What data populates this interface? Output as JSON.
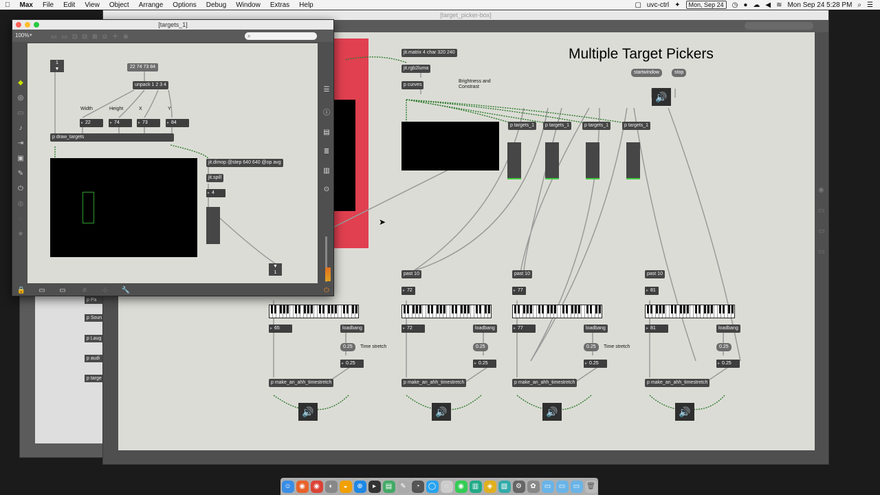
{
  "menubar": {
    "apple": "",
    "app": "Max",
    "items": [
      "File",
      "Edit",
      "View",
      "Object",
      "Arrange",
      "Options",
      "Debug",
      "Window",
      "Extras",
      "Help"
    ],
    "status_item": "uvc-ctrl",
    "date_box": "Mon, Sep 24",
    "clock": "Mon Sep 24  5:28 PM"
  },
  "main_window": {
    "title": "[target_picker-box]",
    "heading": "Multiple Target Pickers",
    "objects": {
      "matrix": "jit.matrix 4 char 320 240",
      "rgb2luma": "jit.rgb2luma",
      "curves": "p curves",
      "brightness_comment": "Brightness and Constrast",
      "startwindow": "startwindow",
      "stop": "stop",
      "targets": [
        "p targets_1",
        "p targets_1",
        "p targets_1",
        "p targets_1"
      ],
      "past": [
        "past 10",
        "past 10",
        "past 10",
        "past 10"
      ],
      "pitch_values": [
        "72",
        "77",
        "81"
      ],
      "note_values": [
        "65",
        "72",
        "77",
        "81"
      ],
      "loadbang": "loadbang",
      "stretch_value": "0.25",
      "time_stretch_comment": "Time stretch",
      "make_ahh": "p make_an_ahh_timestretch"
    }
  },
  "side_window": {
    "objects": [
      "p Pa",
      "p Soun",
      "p Laug",
      "p audi",
      "p targe"
    ]
  },
  "targets_window": {
    "title": "[targets_1]",
    "zoom": "100%",
    "objects": {
      "message": "22 74 73 84",
      "unpack": "unpack 1 2 3 4",
      "labels": [
        "Width",
        "Height",
        "X",
        "Y"
      ],
      "numbers": [
        "22",
        "74",
        "73",
        "84"
      ],
      "draw_targets": "p draw_targets",
      "dimop": "jit.dimop @step 640 640 @op avg",
      "spill": "jit.spill",
      "spill_value": "4",
      "toggle_label": "1",
      "out_label": "1"
    }
  },
  "dock": {
    "apps": [
      "Finder",
      "Firefox",
      "Chrome",
      "Safari",
      "Mail",
      "Music",
      "Terminal",
      "Notes",
      "Messages",
      "Spotify",
      "Max",
      "Preview",
      "Folder",
      "Trash"
    ]
  }
}
